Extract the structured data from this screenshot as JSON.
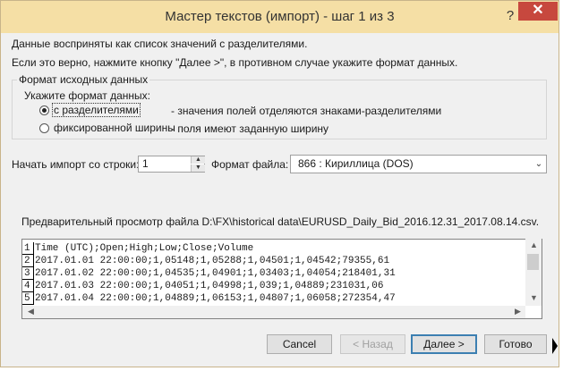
{
  "window": {
    "title": "Мастер текстов (импорт) - шаг 1 из 3",
    "help_label": "?",
    "close_label": "✕"
  },
  "intro": {
    "line1": "Данные восприняты как список значений с разделителями.",
    "line2": "Если это верно, нажмите кнопку \"Далее >\", в противном случае укажите формат данных."
  },
  "source_format": {
    "group_label": "Формат исходных данных",
    "prompt": "Укажите формат данных:",
    "options": [
      {
        "label": "с разделителями",
        "description": "- значения полей отделяются знаками-разделителями",
        "selected": true
      },
      {
        "label": "фиксированной ширины",
        "description": "- поля имеют заданную ширину",
        "selected": false
      }
    ]
  },
  "start_row": {
    "label": "Начать импорт со строки:",
    "value": "1"
  },
  "file_format": {
    "label": "Формат файла:",
    "value": "866 : Кириллица (DOS)"
  },
  "preview": {
    "label": "Предварительный просмотр файла D:\\FX\\historical data\\EURUSD_Daily_Bid_2016.12.31_2017.08.14.csv.",
    "rows": [
      {
        "num": "1",
        "text": "Time (UTC);Open;High;Low;Close;Volume"
      },
      {
        "num": "2",
        "text": "2017.01.01 22:00:00;1,05148;1,05288;1,04501;1,04542;79355,61"
      },
      {
        "num": "3",
        "text": "2017.01.02 22:00:00;1,04535;1,04901;1,03403;1,04054;218401,31"
      },
      {
        "num": "4",
        "text": "2017.01.03 22:00:00;1,04051;1,04998;1,039;1,04889;231031,06"
      },
      {
        "num": "5",
        "text": "2017.01.04 22:00:00;1,04889;1,06153;1,04807;1,06058;272354,47"
      }
    ]
  },
  "buttons": {
    "cancel": "Cancel",
    "back": "< Назад",
    "next": "Далее >",
    "finish": "Готово"
  },
  "colors": {
    "titlebar": "#f5dfa5",
    "close": "#c7483e",
    "default_button_border": "#3c7fb1"
  }
}
